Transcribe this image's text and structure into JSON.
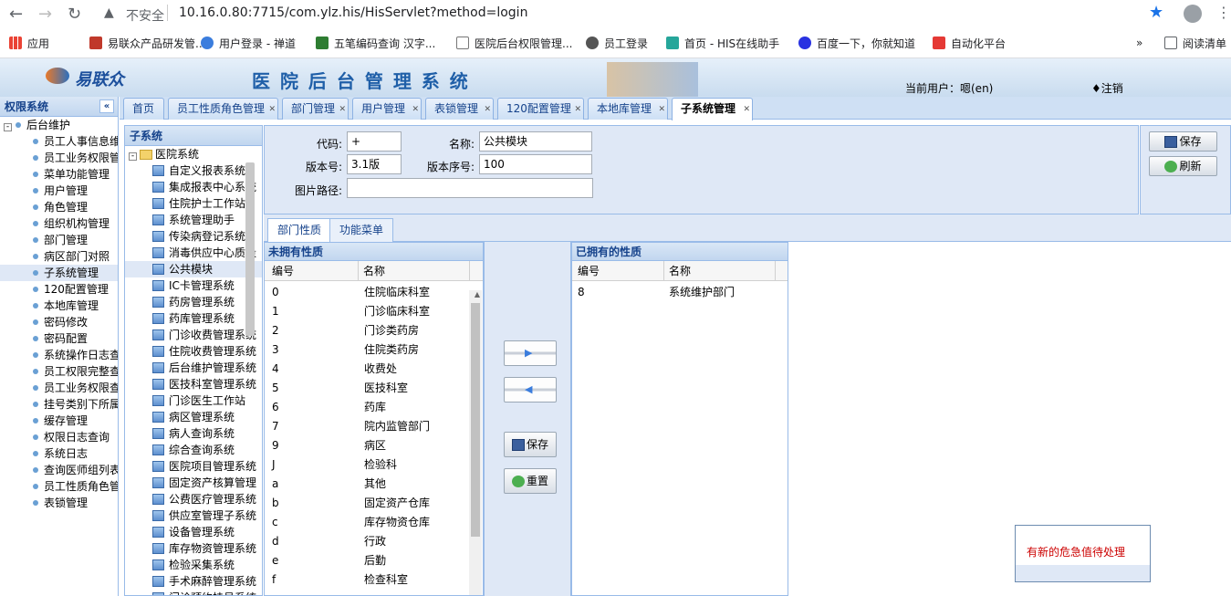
{
  "browser": {
    "insecure_label": "不安全",
    "url": "10.16.0.80:7715/com.ylz.his/HisServlet?method=login",
    "bookmarks": [
      "应用",
      "易联众产品研发管...",
      "用户登录 - 禅道",
      "五笔编码查询 汉字...",
      "医院后台权限管理...",
      "员工登录",
      "首页 - HIS在线助手",
      "百度一下，你就知道",
      "自动化平台"
    ],
    "reading_list": "阅读清单"
  },
  "header": {
    "logo_text": "易联众",
    "system_title": "医 院 后 台 管 理 系 统",
    "current_user": "当前用户：嗯(en)",
    "logout": "♦注销"
  },
  "left_panel": {
    "title": "权限系统",
    "root": "后台维护",
    "items": [
      "员工人事信息维护",
      "员工业务权限管理",
      "菜单功能管理",
      "用户管理",
      "角色管理",
      "组织机构管理",
      "部门管理",
      "病区部门对照",
      "子系统管理",
      "120配置管理",
      "本地库管理",
      "密码修改",
      "密码配置",
      "系统操作日志查询",
      "员工权限完整查询",
      "员工业务权限查询",
      "挂号类别下所属",
      "缓存管理",
      "权限日志查询",
      "系统日志",
      "查询医师组列表",
      "员工性质角色管理",
      "表锁管理"
    ],
    "selected_index": 8
  },
  "tabs": [
    "首页",
    "员工性质角色管理",
    "部门管理",
    "用户管理",
    "表锁管理",
    "120配置管理",
    "本地库管理",
    "子系统管理"
  ],
  "active_tab": 7,
  "subsystem_panel": {
    "title": "子系统",
    "root": "医院系统",
    "items": [
      "自定义报表系统",
      "集成报表中心系统",
      "住院护士工作站",
      "系统管理助手",
      "传染病登记系统",
      "消毒供应中心质量",
      "公共模块",
      "IC卡管理系统",
      "药房管理系统",
      "药库管理系统",
      "门诊收费管理系统",
      "住院收费管理系统",
      "后台维护管理系统",
      "医技科室管理系统",
      "门诊医生工作站",
      "病区管理系统",
      "病人查询系统",
      "综合查询系统",
      "医院项目管理系统",
      "固定资产核算管理",
      "公费医疗管理系统",
      "供应室管理子系统",
      "设备管理系统",
      "库存物资管理系统",
      "检验采集系统",
      "手术麻醉管理系统",
      "门诊预约挂号系统"
    ],
    "selected_index": 6
  },
  "form": {
    "code_label": "代码:",
    "code_value": "+",
    "name_label": "名称:",
    "name_value": "公共模块",
    "version_label": "版本号:",
    "version_value": "3.1版",
    "version_seq_label": "版本序号:",
    "version_seq_value": "100",
    "image_path_label": "图片路径:",
    "image_path_value": "",
    "save_label": "保存",
    "refresh_label": "刷新"
  },
  "sub_tabs": [
    "部门性质",
    "功能菜单"
  ],
  "unowned": {
    "title": "未拥有性质",
    "col_code": "编号",
    "col_name": "名称",
    "rows": [
      [
        "0",
        "住院临床科室"
      ],
      [
        "1",
        "门诊临床科室"
      ],
      [
        "2",
        "门诊类药房"
      ],
      [
        "3",
        "住院类药房"
      ],
      [
        "4",
        "收费处"
      ],
      [
        "5",
        "医技科室"
      ],
      [
        "6",
        "药库"
      ],
      [
        "7",
        "院内监管部门"
      ],
      [
        "9",
        "病区"
      ],
      [
        "J",
        "检验科"
      ],
      [
        "a",
        "其他"
      ],
      [
        "b",
        "固定资产仓库"
      ],
      [
        "c",
        "库存物资仓库"
      ],
      [
        "d",
        "行政"
      ],
      [
        "e",
        "后勤"
      ],
      [
        "f",
        "检查科室"
      ]
    ]
  },
  "owned": {
    "title": "已拥有的性质",
    "col_code": "编号",
    "col_name": "名称",
    "rows": [
      [
        "8",
        "系统维护部门"
      ]
    ]
  },
  "middle": {
    "save_label": "保存",
    "reset_label": "重置"
  },
  "alert_text": "有新的危急值待处理"
}
